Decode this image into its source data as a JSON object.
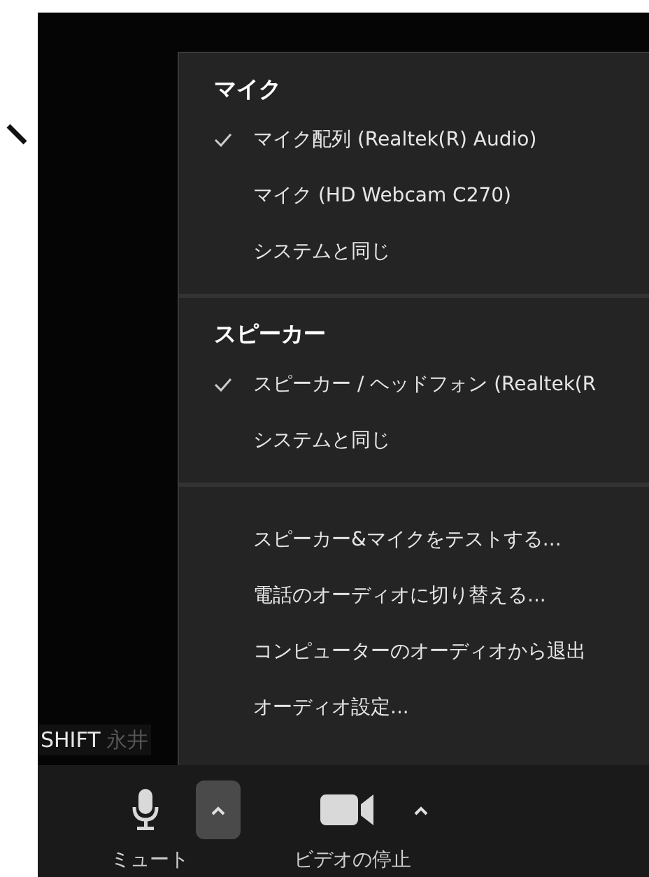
{
  "menu": {
    "sections": [
      {
        "title": "マイク",
        "items": [
          {
            "label": "マイク配列 (Realtek(R) Audio)",
            "checked": true
          },
          {
            "label": "マイク (HD Webcam C270)",
            "checked": false
          },
          {
            "label": "システムと同じ",
            "checked": false
          }
        ]
      },
      {
        "title": "スピーカー",
        "items": [
          {
            "label": "スピーカー / ヘッドフォン (Realtek(R",
            "checked": true
          },
          {
            "label": "システムと同じ",
            "checked": false
          }
        ]
      },
      {
        "items": [
          {
            "label": "スピーカー&マイクをテストする...",
            "checked": false
          },
          {
            "label": "電話のオーディオに切り替える...",
            "checked": false
          },
          {
            "label": "コンピューターのオーディオから退出",
            "checked": false
          },
          {
            "label": "オーディオ設定...",
            "checked": false
          }
        ]
      }
    ]
  },
  "video_name_label": [
    "SHIFT",
    "永井"
  ],
  "toolbar": [
    {
      "kind": "mic",
      "label": "ミュート",
      "menu_open": true
    },
    {
      "kind": "video",
      "label": "ビデオの停止",
      "menu_open": false
    }
  ]
}
